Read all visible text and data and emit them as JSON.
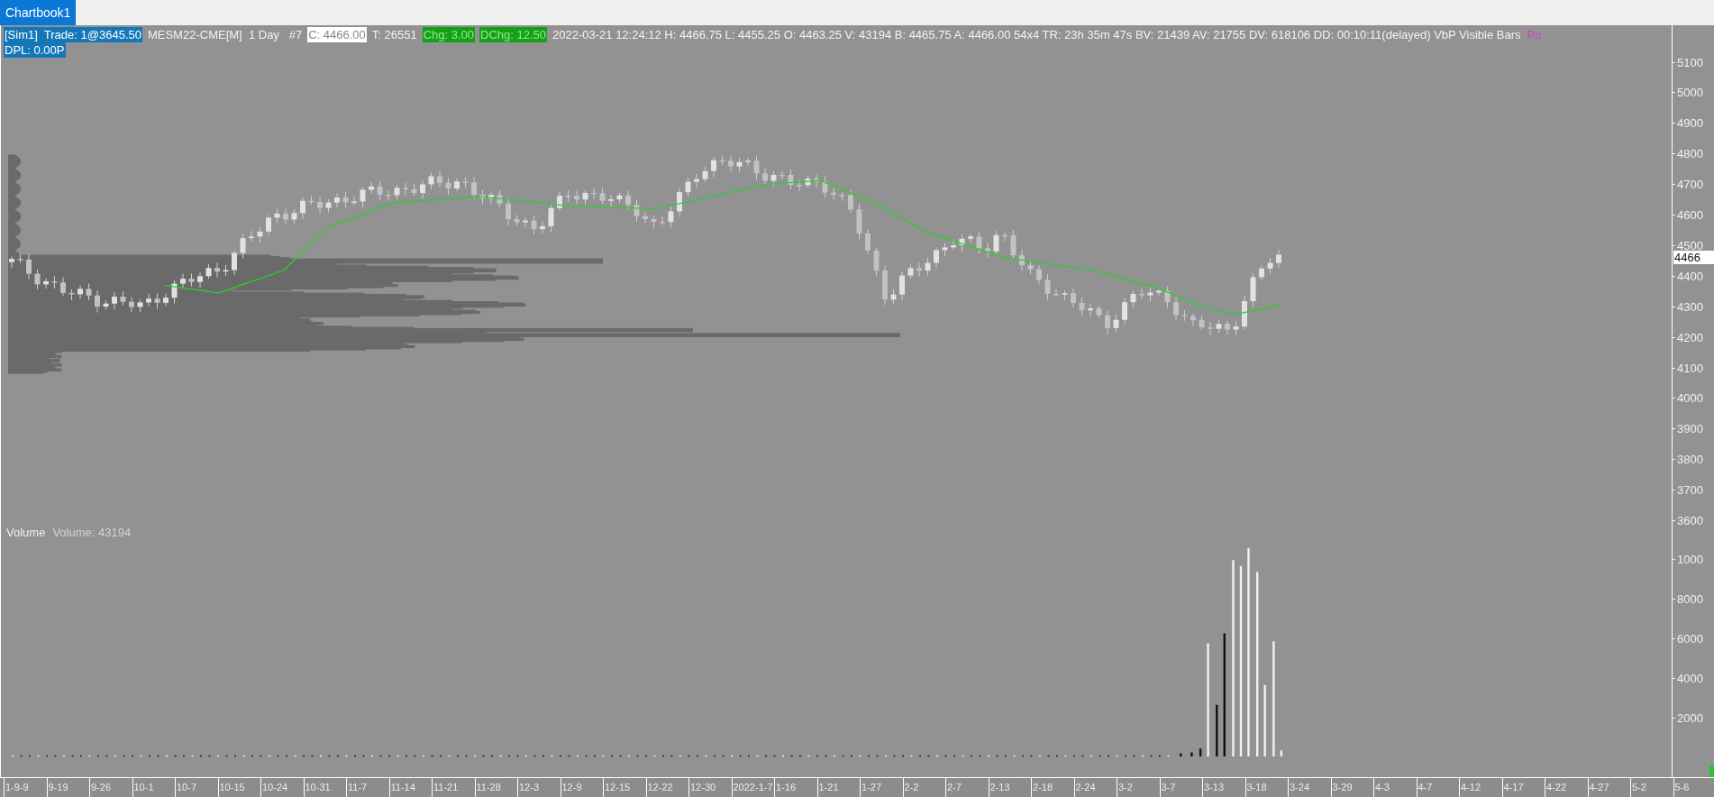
{
  "tab": {
    "label": "Chartbook1",
    "selected": true
  },
  "header": {
    "items": [
      {
        "text": "[Sim1]  Trade: 1@3645.50",
        "kind": "account"
      },
      {
        "text": "MESM22-CME[M]  1 Day   #7",
        "kind": "plain"
      },
      {
        "text": "C: 4466.00",
        "kind": "close"
      },
      {
        "text": "T: 26551",
        "kind": "plain"
      },
      {
        "text": "Chg: 3.00",
        "kind": "change"
      },
      {
        "text": "DChg: 12.50",
        "kind": "change"
      },
      {
        "text": "2022-03-21 12:24:12 H: 4466.75 L: 4455.25 O: 4463.25 V: 43194 B: 4465.75 A: 4466.00 54x4 TR: 23h 35m 47s BV: 21439 AV: 21755 DV: 618106 DD: 00:10:11(delayed) VbP Visible Bars",
        "kind": "plain"
      },
      {
        "text": "Po",
        "kind": "study"
      }
    ],
    "second_line": {
      "text": "DPL: 0.00P",
      "kind": "account"
    }
  },
  "price_axis": {
    "ticks": [
      "5100",
      "5000",
      "4900",
      "4800",
      "4700",
      "4600",
      "4500",
      "4400",
      "4300",
      "4200",
      "4100",
      "4000",
      "3900",
      "3800",
      "3700",
      "3600"
    ],
    "last_price": "4466"
  },
  "volume_panel": {
    "title": "Volume",
    "reading": "Volume: 43194",
    "ticks": [
      "1000",
      "8000",
      "6000",
      "4000",
      "2000"
    ]
  },
  "time_axis": {
    "labels": [
      "1-9-9",
      "9-19",
      "9-26",
      "10-1",
      "10-7",
      "10-15",
      "10-24",
      "10-31",
      "11-7",
      "11-14",
      "11-21",
      "11-28",
      "12-3",
      "12-9",
      "12-15",
      "12-22",
      "12-30",
      "2022-1-7",
      "1-16",
      "1-21",
      "1-27",
      "2-2",
      "2-7",
      "2-13",
      "2-18",
      "2-24",
      "3-2",
      "3-7",
      "3-13",
      "3-18",
      "3-24",
      "3-29",
      "4-3",
      "4-7",
      "4-12",
      "4-17",
      "4-22",
      "4-27",
      "5-2",
      "5-6"
    ]
  }
}
